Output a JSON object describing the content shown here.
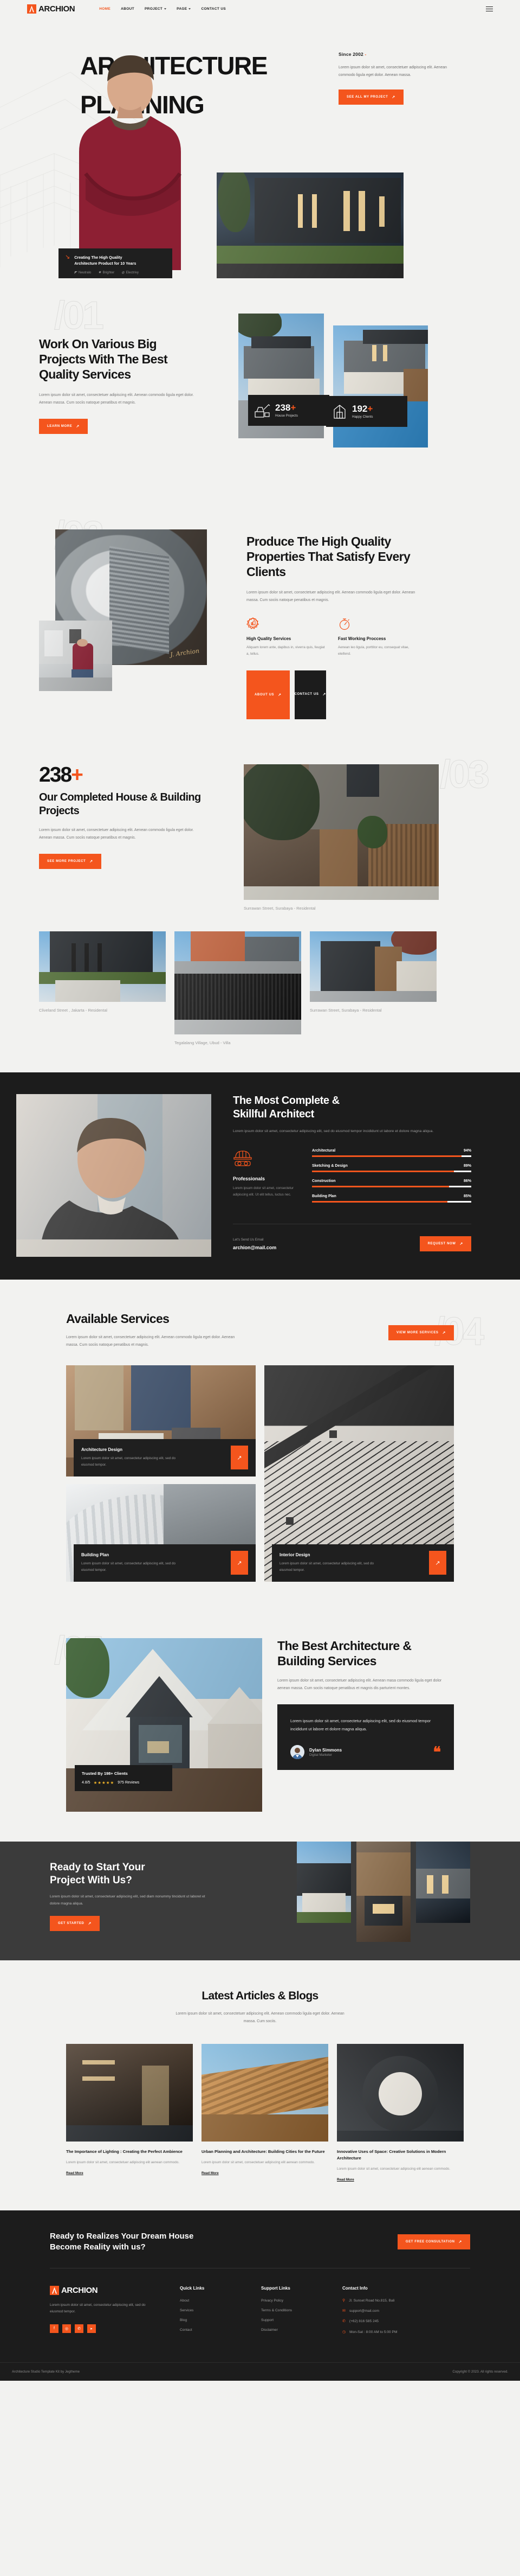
{
  "brand": {
    "name": "ARCHION",
    "accent": "#f4551d",
    "dark": "#1c1c1c"
  },
  "header": {
    "nav": [
      {
        "label": "HOME",
        "active": true,
        "caret": false
      },
      {
        "label": "ABOUT",
        "active": false,
        "caret": false
      },
      {
        "label": "PROJECT",
        "active": false,
        "caret": true
      },
      {
        "label": "PAGE",
        "active": false,
        "caret": true
      },
      {
        "label": "CONTACT US",
        "active": false,
        "caret": false
      }
    ],
    "menu_icon": "hamburger-icon"
  },
  "hero": {
    "title_line1": "ARCHITECTURE",
    "title_line2": "PLANNING",
    "amp": "&",
    "since": "Since 2002",
    "since_dash": "-",
    "desc": "Lorem ipsum dolor sit amet, consectetuer adipiscing elit. Aenean commodo ligula eget dolor. Aenean massa.",
    "cta": "SEE ALL MY PROJECT",
    "card": {
      "icon": "arrow-down-right-icon",
      "title_line1": "Creating The High Quality",
      "title_line2": "Architecture Product for 10 Years",
      "brands": [
        {
          "icon": "neutralo-icon",
          "label": "Neutralo"
        },
        {
          "icon": "brighter-icon",
          "label": "Brighter"
        },
        {
          "icon": "electrivy-icon",
          "label": "Electrivy"
        }
      ]
    }
  },
  "section01": {
    "ghost": "/01",
    "title": "Work On Various Big Projects With The Best Quality Services",
    "desc": "Lorem ipsum dolor sit amet, consectetuer adipiscing elit. Aenean commodo ligula eget dolor. Aenean massa. Cum sociis natoque penatibus et magnis.",
    "cta": "LEARN MORE",
    "stats": [
      {
        "icon": "excavator-icon",
        "value": "238",
        "plus": "+",
        "label": "House Projects"
      },
      {
        "icon": "house-outline-icon",
        "value": "192",
        "plus": "+",
        "label": "Happy Clients"
      }
    ]
  },
  "section02": {
    "ghost": "/02",
    "title": "Produce The High Quality Properties That Satisfy Every Clients",
    "desc": "Lorem ipsum dolor sit amet, consectetuer adipiscing elit. Aenean commodo ligula eget dolor. Aenean massa. Cum sociis natoque penatibus et magnis.",
    "signature": "J. Archion",
    "features": [
      {
        "icon": "quality-badge-icon",
        "title": "High Quality Services",
        "desc": "Aliquam lorem ante, dapibus in, viverra quis, feugiat a, tellus."
      },
      {
        "icon": "stopwatch-icon",
        "title": "Fast Working Proccess",
        "desc": "Aenean leo ligula, porttitor eu, consequat vitae, eleifend."
      }
    ],
    "btn_primary": "ABOUT US",
    "btn_secondary": "CONTACT US"
  },
  "section03": {
    "ghost": "/03",
    "counter": "238",
    "counter_plus": "+",
    "title": "Our Completed House & Building Projects",
    "desc": "Lorem ipsum dolor sit amet, consectetuer adipiscing elit. Aenean commodo ligula eget dolor. Aenean massa. Cum sociis natoque penatibus et magnis.",
    "cta": "SEE MORE PROJECT",
    "feature_project": {
      "name": "Surrawan Street, Surabaya",
      "type": " - Residental"
    },
    "projects": [
      {
        "name": "Cliveland Street , Jakarta",
        "type": " - Residental"
      },
      {
        "name": "Tegalalang Village, Ubud",
        "type": " - Villa"
      },
      {
        "name": "Surrawan Street, Surabaya",
        "type": " - Residental"
      }
    ]
  },
  "architect": {
    "title_line1": "The Most Complete &",
    "title_line2": "Skillful Architect",
    "desc": "Lorem ipsum dolor sit amet, consectetur adipiscing elit, sed do eiusmod tempor incididunt ut labore et dolore magna aliqua.",
    "pro": {
      "icon": "helmet-goggles-icon",
      "title": "Professionals",
      "desc": "Lorem ipsum dolor sit amet, consectetur adipiscing elit. Ut elit tellus, luctus nec."
    },
    "skills": [
      {
        "label": "Architectural",
        "value": "94%",
        "pct": 94
      },
      {
        "label": "Sketching & Design",
        "value": "89%",
        "pct": 89
      },
      {
        "label": "Construction",
        "value": "86%",
        "pct": 86
      },
      {
        "label": "Building Plan",
        "value": "85%",
        "pct": 85
      }
    ],
    "email_label": "Let's Send Us Email",
    "email": "archion@mail.com",
    "cta": "REQUEST NOW"
  },
  "services": {
    "ghost": "/04",
    "title": "Available Services",
    "desc": "Lorem ipsum dolor sit amet, consectetuer adipiscing elit. Aenean commodo ligula eget dolor. Aenean massa. Cum sociis natoque penatibus et magnis.",
    "cta": "VIEW MORE SERVICES",
    "items": [
      {
        "title": "Architecture Design",
        "desc": "Lorem ipsum dolor sit amet, consectetur adipiscing elit, sed do eiusmod tempor.",
        "arrow": "arrow-up-right-icon"
      },
      {
        "title": "Building Plan",
        "desc": "Lorem ipsum dolor sit amet, consectetur adipiscing elit, sed do eiusmod tempor.",
        "arrow": "arrow-up-right-icon"
      },
      {
        "title": "Interior Design",
        "desc": "Lorem ipsum dolor sit amet, consectetur adipiscing elit, sed do eiusmod tempor.",
        "arrow": "arrow-up-right-icon"
      }
    ]
  },
  "best": {
    "ghost": "/05",
    "title_line1": "The Best Architecture &",
    "title_line2": "Building Services",
    "desc": "Lorem ipsum dolor sit amet, consectetuer adipiscing elit. Aenean masa commodo ligula eget dolor aenean massa. Cum sociis natoque penatibus et magnis dis parturient montes.",
    "trust": {
      "headline": "Trusted By 198+ Clients",
      "score": "4.8/5",
      "stars": "★★★★★",
      "reviews": "975 Reviews"
    },
    "testimonial": {
      "quote": "Lorem ipsum dolor sit amet, consectetur adipiscing elit, sed do eiusmod tempor incididunt ut labore et dolore magna aliqua.",
      "author": "Dylan Simmons",
      "role": "Digital Marketer",
      "mark": "❝"
    }
  },
  "cta_band": {
    "title_line1": "Ready to Start Your",
    "title_line2": "Project With Us?",
    "desc": "Lorem ipsum dolor sit amet, consectetuer adipiscing elit, sed diam nonummy tincidunt ut laboret et dolore magna aliqua.",
    "cta": "GET STARTED"
  },
  "blog": {
    "title": "Latest Articles & Blogs",
    "desc": "Lorem ipsum dolor sit amet, consectetuer adipiscing elit. Aenean commodo ligula eget dolor. Aenean massa. Cum sociis.",
    "posts": [
      {
        "title": "The Importance of Lighting : Creating the Perfect Ambience",
        "excerpt": "Lorem ipsum dolor sit amet, consectetuer adipiscing elit aenean commodo.",
        "link": "Read More"
      },
      {
        "title": "Urban Planning and Architecture: Building Cities for the Future",
        "excerpt": "Lorem ipsum dolor sit amet, consectetuer adipiscing elit aenean commodo.",
        "link": "Read More"
      },
      {
        "title": "Innovative Uses of Space: Creative Solutions in Modern Architecture",
        "excerpt": "Lorem ipsum dolor sit amet, consectetuer adipiscing elit aenean commodo.",
        "link": "Read More"
      }
    ]
  },
  "footer": {
    "cta_title_line1": "Ready to Realizes Your Dream House",
    "cta_title_line2": "Become Reality with us?",
    "cta_button": "GET FREE CONSULTATION",
    "brand_desc": "Lorem ipsum dolor sit amet, consectetur adipiscing elit, sed do eiusmod tempor.",
    "socials": [
      {
        "icon": "facebook-icon",
        "glyph": "f"
      },
      {
        "icon": "instagram-icon",
        "glyph": "◎"
      },
      {
        "icon": "whatsapp-icon",
        "glyph": "✆"
      },
      {
        "icon": "youtube-icon",
        "glyph": "▸"
      }
    ],
    "quick": {
      "title": "Quick Links",
      "links": [
        "About",
        "Services",
        "Blog",
        "Contact"
      ]
    },
    "support": {
      "title": "Support Links",
      "links": [
        "Privacy Policy",
        "Terms & Conditions",
        "Support",
        "Disclaimer"
      ]
    },
    "contact": {
      "title": "Contact Info",
      "items": [
        {
          "icon": "location-pin-icon",
          "text": "Jl. Sunset Road No.815, Bali"
        },
        {
          "icon": "envelope-icon",
          "text": "support@mail.com"
        },
        {
          "icon": "phone-icon",
          "text": "(+62) 816 585 245"
        },
        {
          "icon": "clock-icon",
          "text": "Mon-Sat : 8:00 AM to 5:00 PM"
        }
      ]
    },
    "credit": "Architecture Studio Template Kit by Jegtheme",
    "copyright": "Copyright © 2023. All rights reserved."
  }
}
